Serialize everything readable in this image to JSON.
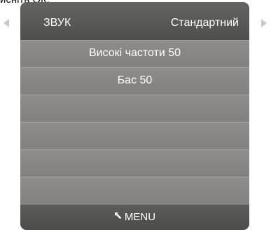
{
  "top_fragment": "исніть ОК.",
  "menu": {
    "title": "ЗВУК",
    "mode": "Стандартний",
    "items": [
      {
        "label": "Високі частоти 50"
      },
      {
        "label": "Бас 50"
      },
      {
        "label": ""
      },
      {
        "label": ""
      },
      {
        "label": ""
      },
      {
        "label": ""
      }
    ],
    "footer_label": "MENU"
  },
  "icons": {
    "nav_left": "triangle-left-icon",
    "nav_right": "triangle-right-icon",
    "back": "return-arrow-icon"
  },
  "colors": {
    "panel": "#7f7e7a",
    "header": "#575754",
    "footer": "#4f4f4c",
    "text": "#ffffff",
    "nav_arrow": "#c7c7c7"
  }
}
